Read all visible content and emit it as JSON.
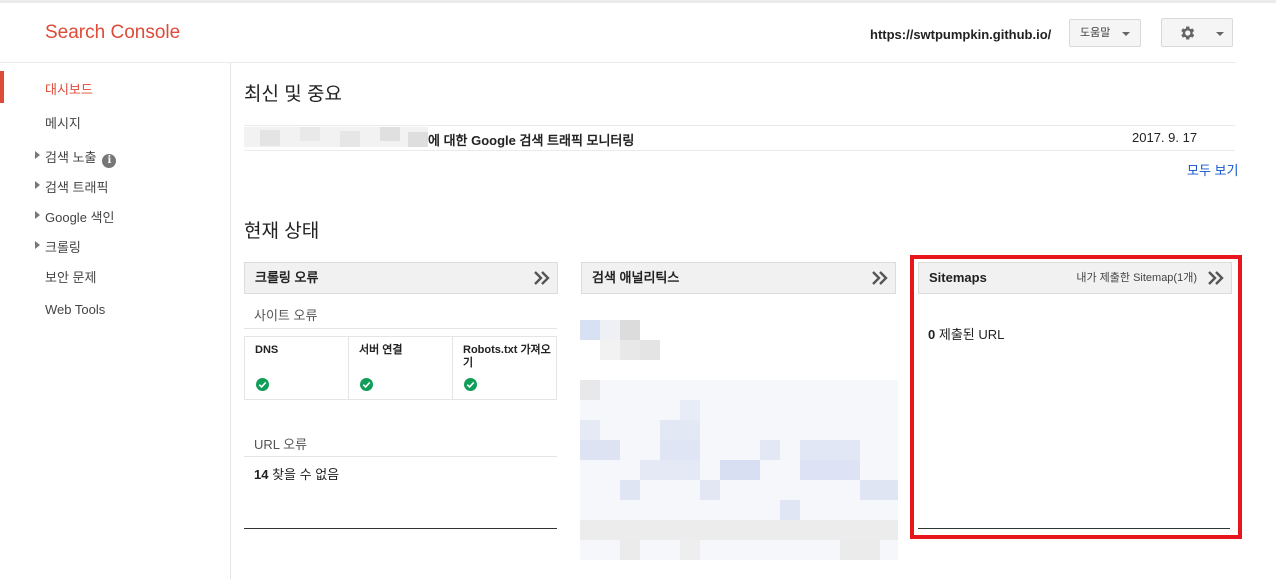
{
  "header": {
    "app_title": "Search Console",
    "site_url": "https://swtpumpkin.github.io/",
    "help_label": "도움말",
    "settings_icon": "gear-icon"
  },
  "sidebar": {
    "items": [
      {
        "label": "대시보드",
        "active": true,
        "expandable": false
      },
      {
        "label": "메시지",
        "active": false,
        "expandable": false
      },
      {
        "label": "검색 노출",
        "active": false,
        "expandable": true,
        "info_icon": true
      },
      {
        "label": "검색 트래픽",
        "active": false,
        "expandable": true
      },
      {
        "label": "Google 색인",
        "active": false,
        "expandable": true
      },
      {
        "label": "크롤링",
        "active": false,
        "expandable": true
      },
      {
        "label": "보안 문제",
        "active": false,
        "expandable": false
      },
      {
        "label": "Web Tools",
        "active": false,
        "expandable": false
      }
    ]
  },
  "recent": {
    "title": "최신 및 중요",
    "message_text": "에 대한 Google 검색 트래픽 모니터링",
    "message_date": "2017. 9. 17",
    "see_all_label": "모두 보기"
  },
  "status": {
    "title": "현재 상태",
    "crawl_errors": {
      "header": "크롤링 오류",
      "site_errors_label": "사이트 오류",
      "columns": [
        {
          "label": "DNS",
          "status": "ok"
        },
        {
          "label": "서버 연결",
          "status": "ok"
        },
        {
          "label": "Robots.txt 가져오기",
          "status": "ok"
        }
      ],
      "url_errors_label": "URL 오류",
      "url_errors_count": "14",
      "url_errors_text": "찾을 수 없음"
    },
    "analytics": {
      "header": "검색 애널리틱스"
    },
    "sitemaps": {
      "header": "Sitemaps",
      "submitted_label": "내가 제출한 Sitemap(1개)",
      "count": "0",
      "count_text": "제출된 URL"
    }
  },
  "colors": {
    "brand": "#dd4b39",
    "link": "#1155cc",
    "check": "#0f9d58",
    "highlight": "#e8161c"
  }
}
